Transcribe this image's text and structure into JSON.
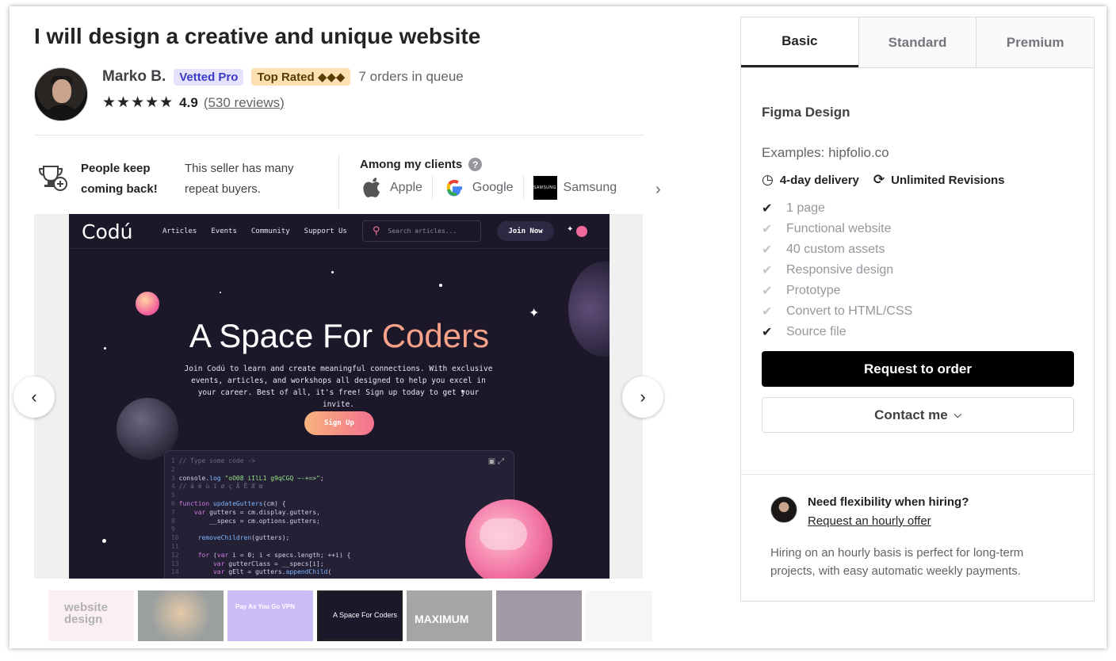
{
  "gig": {
    "title": "I will design a creative and unique website"
  },
  "seller": {
    "name": "Marko B.",
    "badge_vetted": "Vetted Pro",
    "badge_top_rated": "Top Rated ◆◆◆",
    "queue": "7 orders in queue",
    "stars": "★★★★★",
    "rating": "4.9",
    "reviews": "(530 reviews)"
  },
  "highlights": {
    "keep_title": "People keep coming back!",
    "keep_text": "This seller has many repeat buyers.",
    "clients_title": "Among my clients",
    "clients": [
      {
        "name": "Apple",
        "icon": "apple-logo"
      },
      {
        "name": "Google",
        "icon": "google-logo"
      },
      {
        "name": "Samsung",
        "icon": "samsung-logo",
        "logo_text": "SAMSUNG"
      }
    ]
  },
  "preview": {
    "brand": "Codú",
    "nav": [
      "Articles",
      "Events",
      "Community",
      "Support Us"
    ],
    "search_placeholder": "Search articles...",
    "join": "Join Now",
    "headline_a": "A Space For ",
    "headline_b": "Coders",
    "subtitle": "Join Codú to learn and create meaningful connections. With exclusive events, articles, and workshops all designed to help you excel in your career. Best of all, it's free! Sign up today to get your invite.",
    "signup": "Sign Up"
  },
  "thumbnails": {
    "t0": "website design",
    "t2": "Pay As You Go VPN",
    "t3": "A Space For Coders",
    "t4": "MAXIMUM"
  },
  "package": {
    "tabs": [
      "Basic",
      "Standard",
      "Premium"
    ],
    "title": "Figma Design",
    "examples": "Examples: hipfolio.co",
    "delivery": "4-day delivery",
    "revisions": "Unlimited Revisions",
    "features": [
      {
        "label": "1 page",
        "included": true
      },
      {
        "label": "Functional website",
        "included": false
      },
      {
        "label": "40 custom assets",
        "included": false
      },
      {
        "label": "Responsive design",
        "included": false
      },
      {
        "label": "Prototype",
        "included": false
      },
      {
        "label": "Convert to HTML/CSS",
        "included": false
      },
      {
        "label": "Source file",
        "included": true
      }
    ],
    "request_btn": "Request to order",
    "contact_btn": "Contact me"
  },
  "hourly": {
    "title": "Need flexibility when hiring?",
    "link": "Request an hourly offer",
    "text": "Hiring on an hourly basis is perfect for long-term projects, with easy automatic weekly payments."
  }
}
